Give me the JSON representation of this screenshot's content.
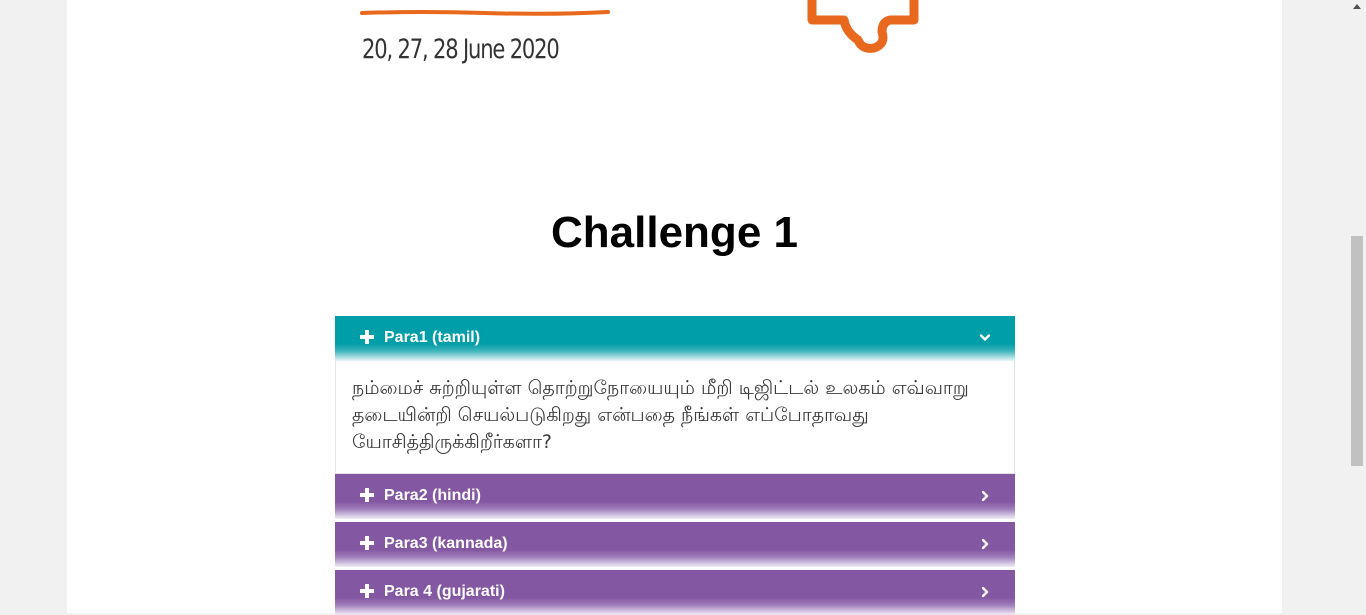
{
  "banner": {
    "date": "20, 27, 28 June 2020",
    "accent_color": "#e8681d"
  },
  "page_title": "Challenge 1",
  "accordion": {
    "items": [
      {
        "label": "Para1 (tamil)",
        "expanded": true,
        "color": "#009ea8",
        "body": "நம்மைச் சுற்றியுள்ள தொற்றுநோயையும் மீறி டிஜிட்டல் உலகம் எவ்வாறு தடையின்றி செயல்படுகிறது என்பதை நீங்கள் எப்போதாவது யோசித்திருக்கிறீர்களா?"
      },
      {
        "label": "Para2 (hindi)",
        "expanded": false,
        "color": "#8457a2"
      },
      {
        "label": "Para3 (kannada)",
        "expanded": false,
        "color": "#8457a2"
      },
      {
        "label": "Para 4 (gujarati)",
        "expanded": false,
        "color": "#8457a2"
      }
    ],
    "icons": {
      "toggle": "plus-icon",
      "expanded": "chevron-down-icon",
      "collapsed": "chevron-right-icon"
    }
  }
}
